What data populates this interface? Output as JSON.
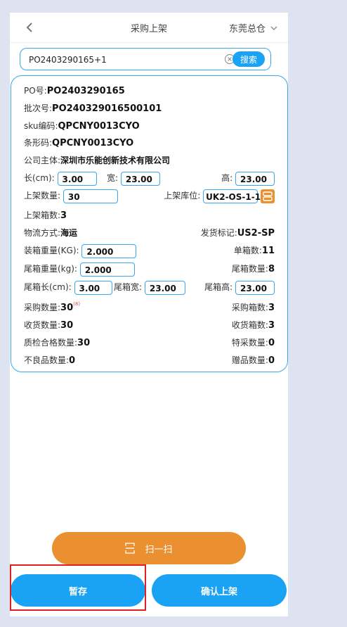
{
  "header": {
    "title": "采购上架",
    "company": "东莞总仓"
  },
  "search": {
    "value": "PO2403290165+1",
    "button_label": "搜索"
  },
  "detail": {
    "po_label": "PO号:",
    "po_value": "PO2403290165",
    "batch_label": "批次号:",
    "batch_value": "PO240329016500101",
    "sku_label": "sku编码:",
    "sku_value": "QPCNY0013CYO",
    "barcode_label": "条形码:",
    "barcode_value": "QPCNY0013CYO",
    "company_label": "公司主体:",
    "company_value": "深圳市乐能创新技术有限公司",
    "length_label": "长(cm):",
    "length_value": "3.00",
    "width_label": "宽:",
    "width_value": "23.00",
    "height_label": "高:",
    "height_value": "23.00",
    "shelf_qty_label": "上架数量:",
    "shelf_qty_value": "30",
    "location_label": "上架库位:",
    "location_value": "UK2-OS-1-1",
    "shelf_boxes_label": "上架箱数:",
    "shelf_boxes_value": "3",
    "logistics_label": "物流方式:",
    "logistics_value": "海运",
    "ship_mark_label": "发货标记:",
    "ship_mark_value": "US2-SP",
    "box_weight_label": "装箱重量(KG):",
    "box_weight_value": "2.000",
    "single_boxes_label": "单箱数:",
    "single_boxes_value": "11",
    "tail_weight_label": "尾箱重量(kg):",
    "tail_weight_value": "2.000",
    "tail_qty_label": "尾箱数量:",
    "tail_qty_value": "8",
    "tail_len_label": "尾箱长(cm):",
    "tail_len_value": "3.00",
    "tail_wid_label": "尾箱宽:",
    "tail_wid_value": "23.00",
    "tail_hei_label": "尾箱高:",
    "tail_hei_value": "23.00",
    "purchase_qty_label": "采购数量:",
    "purchase_qty_value": "30",
    "purchase_qty_note": "(8)",
    "purchase_boxes_label": "采购箱数:",
    "purchase_boxes_value": "3",
    "received_qty_label": "收货数量:",
    "received_qty_value": "30",
    "received_boxes_label": "收货箱数:",
    "received_boxes_value": "3",
    "qc_qty_label": "质检合格数量:",
    "qc_qty_value": "30",
    "special_qty_label": "特采数量:",
    "special_qty_value": "0",
    "defect_qty_label": "不良品数量:",
    "defect_qty_value": "0",
    "gift_qty_label": "赠品数量:",
    "gift_qty_value": "0"
  },
  "actions": {
    "scan_label": "扫一扫",
    "save_label": "暂存",
    "confirm_label": "确认上架"
  },
  "colors": {
    "accent": "#1aa3f4",
    "scan": "#ea9031",
    "highlight": "#e02020"
  }
}
